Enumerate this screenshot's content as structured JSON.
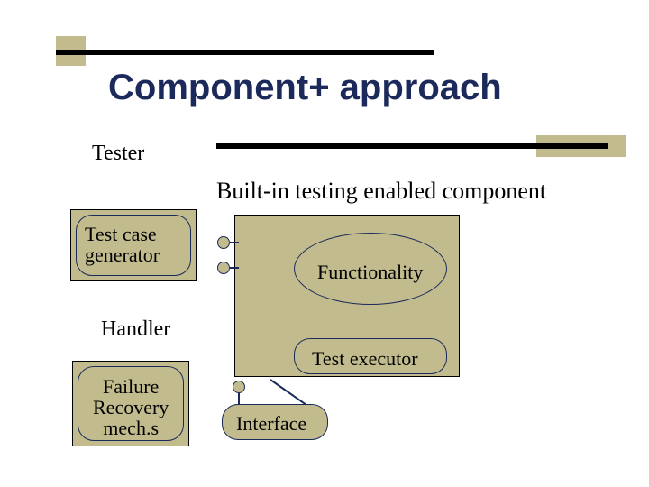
{
  "title": "Component+ approach",
  "labels": {
    "tester": "Tester",
    "bitec": "Built-in testing enabled component",
    "handler": "Handler",
    "interface": "Interface"
  },
  "nodes": {
    "test_case_generator": "Test case\ngenerator",
    "failure_recovery": "Failure\nRecovery\nmech.s",
    "functionality": "Functionality",
    "test_executor": "Test executor"
  },
  "colors": {
    "accent": "#c1bb8e",
    "ink": "#1b2a5a"
  }
}
